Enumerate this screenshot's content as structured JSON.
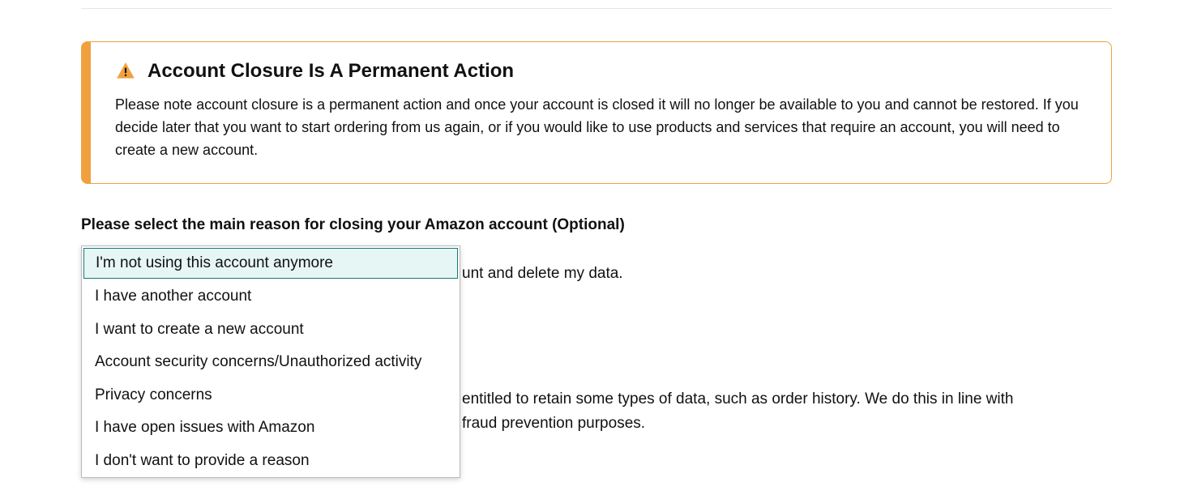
{
  "alert": {
    "title": "Account Closure Is A Permanent Action",
    "body": "Please note account closure is a permanent action and once your account is closed it will no longer be available to you and cannot be restored. If you decide later that you want to start ordering from us again, or if you would like to use products and services that require an account, you will need to create a new account."
  },
  "dropdown": {
    "label": "Please select the main reason for closing your Amazon account (Optional)",
    "options": [
      "I'm not using this account anymore",
      "I have another account",
      "I want to create a new account",
      "Account security concerns/Unauthorized activity",
      "Privacy concerns",
      "I have open issues with Amazon",
      "I don't want to provide a reason"
    ],
    "highlighted_index": 0
  },
  "background": {
    "checkbox_text_fragment": "unt and delete my data.",
    "retention_fragment_1": "entitled to retain some types of data, such as order history. We do this in line with",
    "retention_fragment_2": "fraud prevention purposes."
  }
}
